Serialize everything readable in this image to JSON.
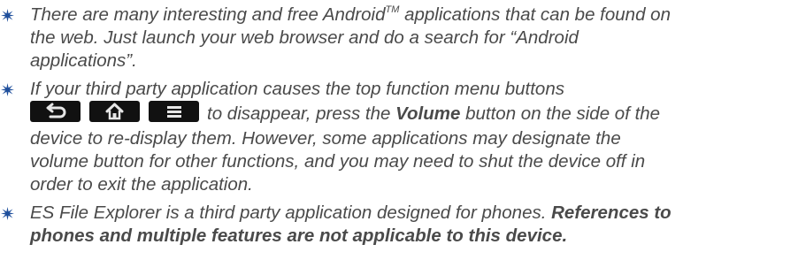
{
  "notes": [
    {
      "lines": [
        "There are many interesting and free Android",
        "TM",
        " applications that can be found on",
        "the web. Just launch your web browser and do a search for “Android",
        "applications”."
      ]
    },
    {
      "lines": [
        "If your third party application causes the top function menu buttons",
        "to disappear, press the ",
        "Volume",
        " button on the side of the",
        "device to re-display them. However, some applications may designate the",
        "volume button for other functions, and you may need to shut the device off in",
        "order to exit the application."
      ],
      "icons": [
        "back-icon",
        "home-icon",
        "menu-icon"
      ]
    },
    {
      "lines": [
        "ES File Explorer is a third party application designed for phones. ",
        "References to",
        "phones and multiple features are not applicable to this device."
      ]
    }
  ],
  "colors": {
    "text": "#4a4a4a",
    "bullet": "#1f4f9c",
    "button_bg": "#111111",
    "button_icon": "#e6e6e6"
  }
}
